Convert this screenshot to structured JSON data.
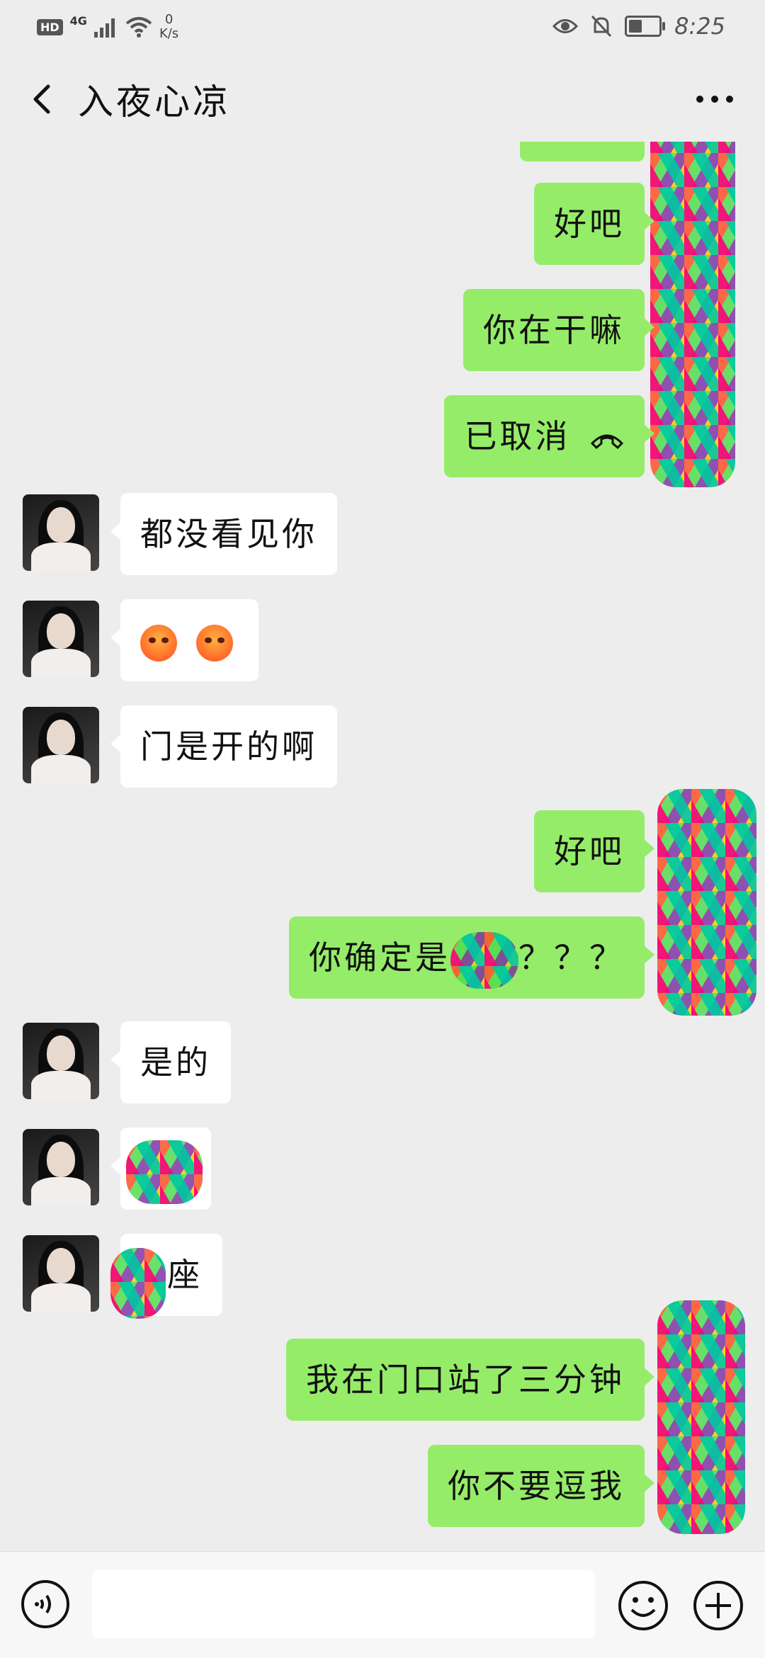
{
  "status_bar": {
    "hd": "HD",
    "network": "4G",
    "speed_value": "0",
    "speed_unit": "K/s",
    "time": "8:25",
    "battery_level": 0.45,
    "icons": [
      "eye-icon",
      "bell-off-icon",
      "battery-icon",
      "wifi-icon",
      "signal-icon"
    ]
  },
  "header": {
    "title": "入夜心凉",
    "back_icon": "chevron-left-icon",
    "more_icon": "more-dots-icon"
  },
  "messages": [
    {
      "side": "out",
      "text": "好吧"
    },
    {
      "side": "out",
      "text": "你在干嘛"
    },
    {
      "side": "out",
      "text": "已取消",
      "icon": "call-ended-icon"
    },
    {
      "side": "in",
      "text": "都没看见你"
    },
    {
      "side": "in",
      "text": "",
      "emoji": [
        "angry-face-emoji",
        "angry-face-emoji"
      ]
    },
    {
      "side": "in",
      "text": "门是开的啊"
    },
    {
      "side": "out",
      "text": "好吧"
    },
    {
      "side": "out",
      "text": "你确定是",
      "suffix": "？？？"
    },
    {
      "side": "in",
      "text": "是的"
    },
    {
      "side": "in",
      "text": ""
    },
    {
      "side": "in",
      "text": "座"
    },
    {
      "side": "out",
      "text": "我在门口站了三分钟"
    },
    {
      "side": "out",
      "text": "你不要逗我"
    }
  ],
  "input_bar": {
    "voice_icon": "voice-icon",
    "emoji_icon": "emoji-icon",
    "plus_icon": "plus-icon",
    "placeholder": ""
  },
  "colors": {
    "background": "#ededed",
    "outgoing_bubble": "#95ec69",
    "incoming_bubble": "#ffffff"
  }
}
